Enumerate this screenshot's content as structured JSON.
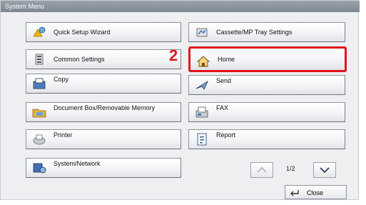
{
  "window": {
    "title": "System Menu"
  },
  "callout": {
    "number": "2"
  },
  "menu": {
    "left": [
      {
        "label": "Quick Setup Wizard",
        "icon": "quick-setup-wizard-icon"
      },
      {
        "label": "Common Settings",
        "icon": "common-settings-icon"
      },
      {
        "label": "Copy",
        "icon": "copy-icon"
      },
      {
        "label": "Document Box/Removable Memory",
        "icon": "document-box-icon"
      },
      {
        "label": "Printer",
        "icon": "printer-icon"
      },
      {
        "label": "System/Network",
        "icon": "system-network-icon"
      }
    ],
    "right": [
      {
        "label": "Cassette/MP Tray Settings",
        "icon": "cassette-tray-icon"
      },
      {
        "label": "Home",
        "icon": "home-icon",
        "highlighted": true
      },
      {
        "label": "Send",
        "icon": "send-icon"
      },
      {
        "label": "FAX",
        "icon": "fax-icon"
      },
      {
        "label": "Report",
        "icon": "report-icon"
      }
    ]
  },
  "pagination": {
    "indicator": "1/2",
    "up_icon": "chevron-up-icon",
    "down_icon": "chevron-down-icon"
  },
  "footer": {
    "close_label": "Close",
    "close_icon": "return-arrow-icon"
  },
  "colors": {
    "highlight": "#e0151d",
    "titlebar": "#8a929c"
  }
}
